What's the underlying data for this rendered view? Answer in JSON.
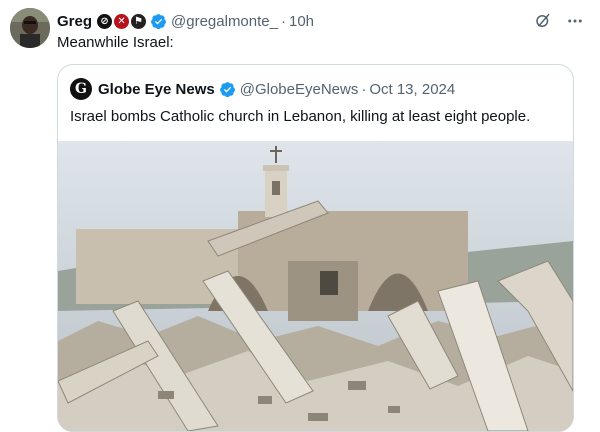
{
  "tweet": {
    "display_name": "Greg",
    "handle": "@gregalmonte_",
    "separator": "·",
    "time": "10h",
    "text": "Meanwhile Israel:",
    "emoji_icons": [
      "no-weapon-icon",
      "bomb-sign-icon",
      "flag-icon"
    ]
  },
  "quote": {
    "logo_letter": "G",
    "display_name": "Globe Eye News",
    "handle": "@GlobeEyeNews",
    "separator": "·",
    "date": "Oct 13, 2024",
    "text": "Israel bombs Catholic church in Lebanon, killing at least eight people."
  },
  "colors": {
    "verified": "#1d9bf0",
    "secondary_text": "#536471",
    "border": "#cfd9de"
  }
}
